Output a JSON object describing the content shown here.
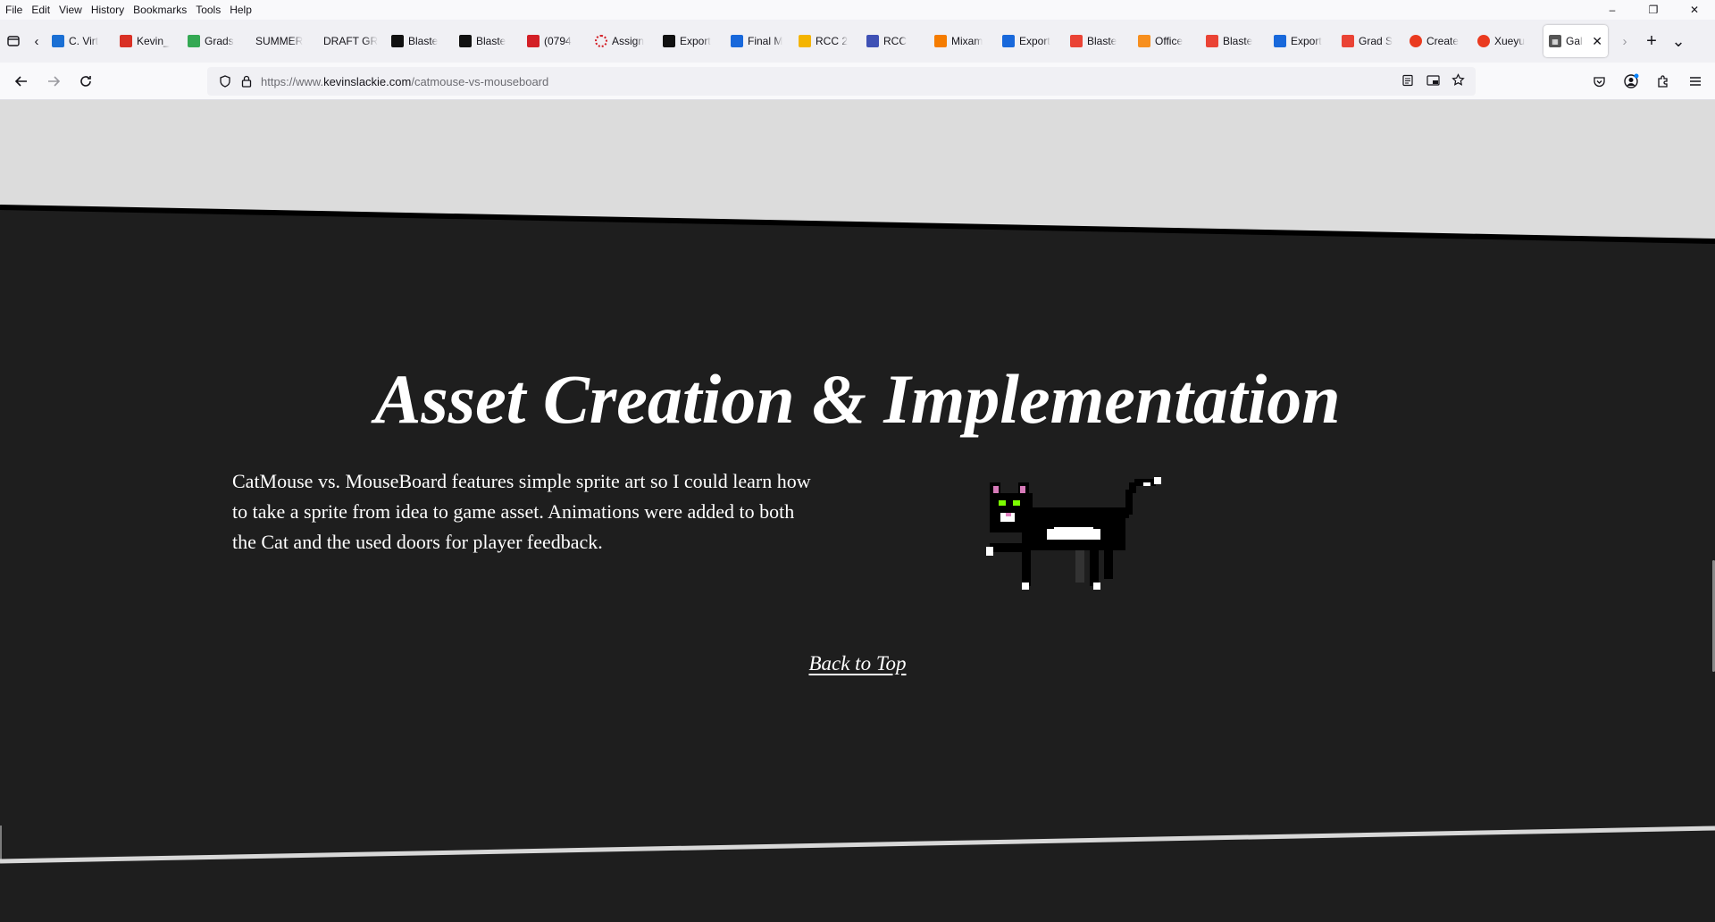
{
  "menubar": {
    "items": [
      "File",
      "Edit",
      "View",
      "History",
      "Bookmarks",
      "Tools",
      "Help"
    ],
    "window_controls": {
      "minimize": "–",
      "restore": "❐",
      "close": "✕"
    }
  },
  "tabs": [
    {
      "label": "C. Virt",
      "icon": "vimeo-like-icon",
      "color": "#1a6fd4"
    },
    {
      "label": "Kevin_",
      "icon": "slides-icon",
      "color": "#d93025"
    },
    {
      "label": "Grads",
      "icon": "pinwheel-icon",
      "color": "#34a853"
    },
    {
      "label": "SUMMER",
      "icon": "",
      "color": ""
    },
    {
      "label": "DRAFT GR",
      "icon": "",
      "color": ""
    },
    {
      "label": "Blaste",
      "icon": "figma-like-icon",
      "color": "#111111"
    },
    {
      "label": "Blaste",
      "icon": "figma-like-icon",
      "color": "#111111"
    },
    {
      "label": "(0794",
      "icon": "red-box-icon",
      "color": "#d31f26"
    },
    {
      "label": "Assign",
      "icon": "spinner-icon",
      "color": "#d31f26"
    },
    {
      "label": "Export",
      "icon": "ck-icon",
      "color": "#111111"
    },
    {
      "label": "Final M",
      "icon": "confluence-icon",
      "color": "#1868db"
    },
    {
      "label": "RCC 2",
      "icon": "yellow-box-icon",
      "color": "#f4b400"
    },
    {
      "label": "RCC",
      "icon": "form-icon",
      "color": "#3f51b5"
    },
    {
      "label": "Mixam",
      "icon": "star-burst-icon",
      "color": "#f57c00"
    },
    {
      "label": "Export",
      "icon": "confluence-icon",
      "color": "#1868db"
    },
    {
      "label": "Blaste",
      "icon": "gmail-icon",
      "color": "#ea4335"
    },
    {
      "label": "Office",
      "icon": "office-icon",
      "color": "#f78f1e"
    },
    {
      "label": "Blaste",
      "icon": "gmail-icon",
      "color": "#ea4335"
    },
    {
      "label": "Export",
      "icon": "atlassian-icon",
      "color": "#1868db"
    },
    {
      "label": "Grad S",
      "icon": "gmail-icon",
      "color": "#ea4335"
    },
    {
      "label": "Create",
      "icon": "red-dot-icon",
      "color": "#ea3a1f"
    },
    {
      "label": "Xueyu",
      "icon": "red-dot-icon",
      "color": "#ea3a1f"
    }
  ],
  "active_tab": {
    "label": "Gal",
    "close": "✕"
  },
  "tabbar_icons": {
    "list_all": "⌄",
    "new_tab": "+",
    "scroll_left": "‹",
    "scroll_right": "›"
  },
  "urlbar": {
    "prefix": "https://www.",
    "domain": "kevinslackie.com",
    "path": "/catmouse-vs-mouseboard"
  },
  "page": {
    "heading": "Asset Creation & Implementation",
    "description": "CatMouse vs. MouseBoard features simple sprite art so I could learn how to take a sprite from idea to game asset. Animations were added to both the Cat and the used doors for player feedback.",
    "back_to_top": "Back to Top",
    "colors": {
      "background_dark": "#1e1e1e",
      "top_band": "#dcdcdc",
      "text": "#ffffff"
    }
  }
}
